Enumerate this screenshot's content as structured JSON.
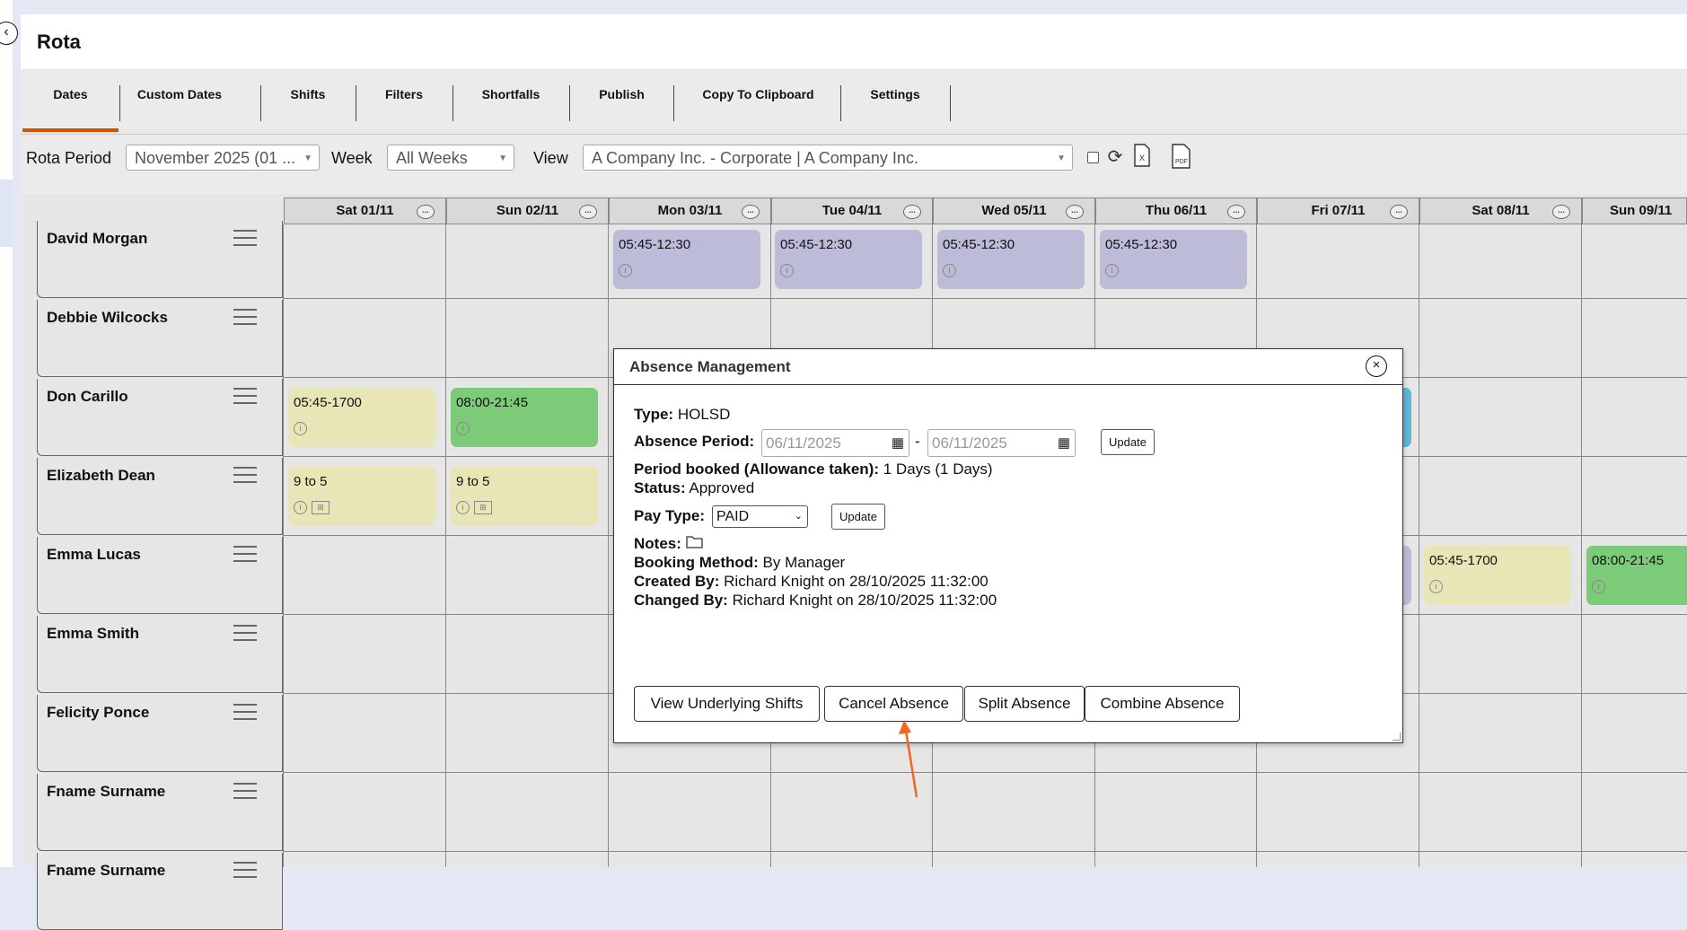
{
  "app": {
    "title": "Rota"
  },
  "tabs": [
    {
      "label": "Dates"
    },
    {
      "label": "Custom Dates"
    },
    {
      "label": "Shifts"
    },
    {
      "label": "Filters"
    },
    {
      "label": "Shortfalls"
    },
    {
      "label": "Publish"
    },
    {
      "label": "Copy To Clipboard"
    },
    {
      "label": "Settings"
    }
  ],
  "toolbar": {
    "rota_period_label": "Rota Period",
    "rota_period_value": "November 2025 (01 ...",
    "week_label": "Week",
    "week_value": "All Weeks",
    "view_label": "View",
    "view_value": "A Company Inc. - Corporate | A Company Inc."
  },
  "days": [
    {
      "label": "Sat 01/11"
    },
    {
      "label": "Sun 02/11"
    },
    {
      "label": "Mon 03/11"
    },
    {
      "label": "Tue 04/11"
    },
    {
      "label": "Wed 05/11"
    },
    {
      "label": "Thu 06/11"
    },
    {
      "label": "Fri 07/11"
    },
    {
      "label": "Sat 08/11"
    },
    {
      "label": "Sun 09/11"
    }
  ],
  "day_menu_label": "...",
  "employees": [
    {
      "name": "David Morgan"
    },
    {
      "name": "Debbie Wilcocks"
    },
    {
      "name": "Don Carillo"
    },
    {
      "name": "Elizabeth Dean"
    },
    {
      "name": "Emma Lucas"
    },
    {
      "name": "Emma Smith"
    },
    {
      "name": "Felicity Ponce"
    },
    {
      "name": "Fname Surname"
    },
    {
      "name": "Fname Surname"
    }
  ],
  "shifts": {
    "dm_mon": "05:45-12:30",
    "dm_tue": "05:45-12:30",
    "dm_wed": "05:45-12:30",
    "dm_thu": "05:45-12:30",
    "dc_sat": "05:45-1700",
    "dc_sun": "08:00-21:45",
    "ed_sat": "9 to 5",
    "ed_sun": "9 to 5",
    "el_sat8": "05:45-1700",
    "el_sun9": "08:00-21:45"
  },
  "colors": {
    "purple_shift": "#bcbcd8",
    "yellow_shift": "#e8e6b6",
    "green_shift": "#7ccb79",
    "accent": "#d35400"
  },
  "modal": {
    "title": "Absence Management",
    "type_label": "Type:",
    "type_value": "HOLSD",
    "period_label": "Absence Period:",
    "period_from": "06/11/2025",
    "period_sep": "-",
    "period_to": "06/11/2025",
    "update_label": "Update",
    "booked_label": "Period booked (Allowance taken):",
    "booked_value": "1 Days (1 Days)",
    "status_label": "Status:",
    "status_value": "Approved",
    "pay_type_label": "Pay Type:",
    "pay_type_value": "PAID",
    "pay_update_label": "Update",
    "notes_label": "Notes:",
    "booking_label": "Booking Method:",
    "booking_value": "By Manager",
    "created_label": "Created By:",
    "created_value": "Richard Knight on 28/10/2025 11:32:00",
    "changed_label": "Changed By:",
    "changed_value": "Richard Knight on 28/10/2025 11:32:00",
    "buttons": {
      "view_shifts": "View Underlying Shifts",
      "cancel_absence": "Cancel Absence",
      "split_absence": "Split Absence",
      "combine_absence": "Combine Absence"
    }
  }
}
